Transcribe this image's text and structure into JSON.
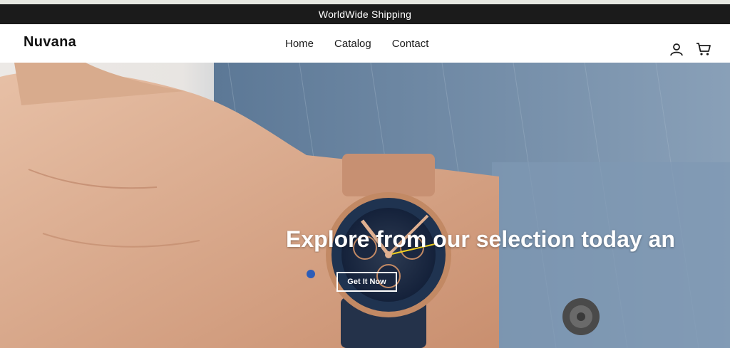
{
  "announcement": {
    "text": "WorldWide Shipping"
  },
  "header": {
    "logo": "Nuvana",
    "nav": [
      {
        "label": "Home"
      },
      {
        "label": "Catalog"
      },
      {
        "label": "Contact"
      }
    ],
    "icons": {
      "account": "user-icon",
      "cart": "cart-icon"
    }
  },
  "hero": {
    "heading": "Explore from our selection today an",
    "button_label": "Get It Now"
  },
  "colors": {
    "announcement_bg": "#1b1b1b",
    "text": "#111111",
    "denim": "#6d87a3"
  }
}
